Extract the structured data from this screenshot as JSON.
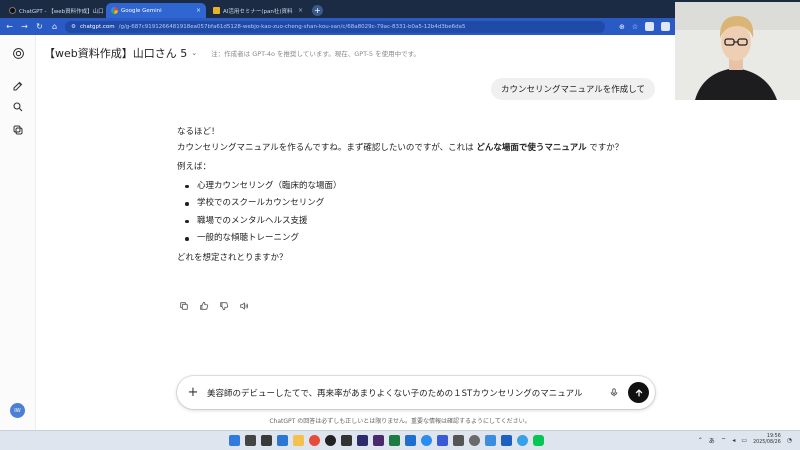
{
  "browser": {
    "tabs": [
      {
        "label": "ChatGPT - 【web資料作成】山口さ...",
        "active": false
      },
      {
        "label": "Google Gemini",
        "active": true
      },
      {
        "label": "AI活用セミナー(pan社)資料",
        "active": false
      }
    ],
    "new_tab": "+",
    "url_host": "chatgpt.com",
    "url_path": "/g/g-687c9191266481918ea057bfa61d5128-webjo-kao-zuo-cheng-shan-kou-san/c/68a8029c-79ac-8331-b0a5-12b4d3be6da5"
  },
  "header": {
    "title": "【web資料作成】山口さん 5",
    "model_note": "注：作成者は GPT-4o を推奨しています。現在、GPT-5 を使用中です。"
  },
  "conversation": {
    "user_message": "カウンセリングマニュアルを作成して",
    "answer": {
      "line1": "なるほど！",
      "line2_prefix": "カウンセリングマニュアルを作るんですね。まず確認したいのですが、これは ",
      "line2_bold": "どんな場面で使うマニュアル",
      "line2_suffix": " ですか？",
      "examples_label": "例えば：",
      "examples": [
        "心理カウンセリング（臨床的な場面）",
        "学校でのスクールカウンセリング",
        "職場でのメンタルヘルス支援",
        "一般的な傾聴トレーニング"
      ],
      "question": "どれを想定されとりますか？"
    }
  },
  "composer": {
    "text": "美容師のデビューしたてで、再来率があまりよくない子のための１STカウンセリングのマニュアル"
  },
  "disclaimer": "ChatGPT の回答は必ずしも正しいとは限りません。重要な情報は確認するようにしてください。",
  "user": {
    "avatar_initials": "IW"
  },
  "taskbar": {
    "time": "19:56",
    "date": "2025/08/26",
    "ime": "あ"
  },
  "colors": {
    "tabbar": "#1b2b44",
    "addressbar": "#2a5bc4",
    "send_button": "#111111"
  }
}
